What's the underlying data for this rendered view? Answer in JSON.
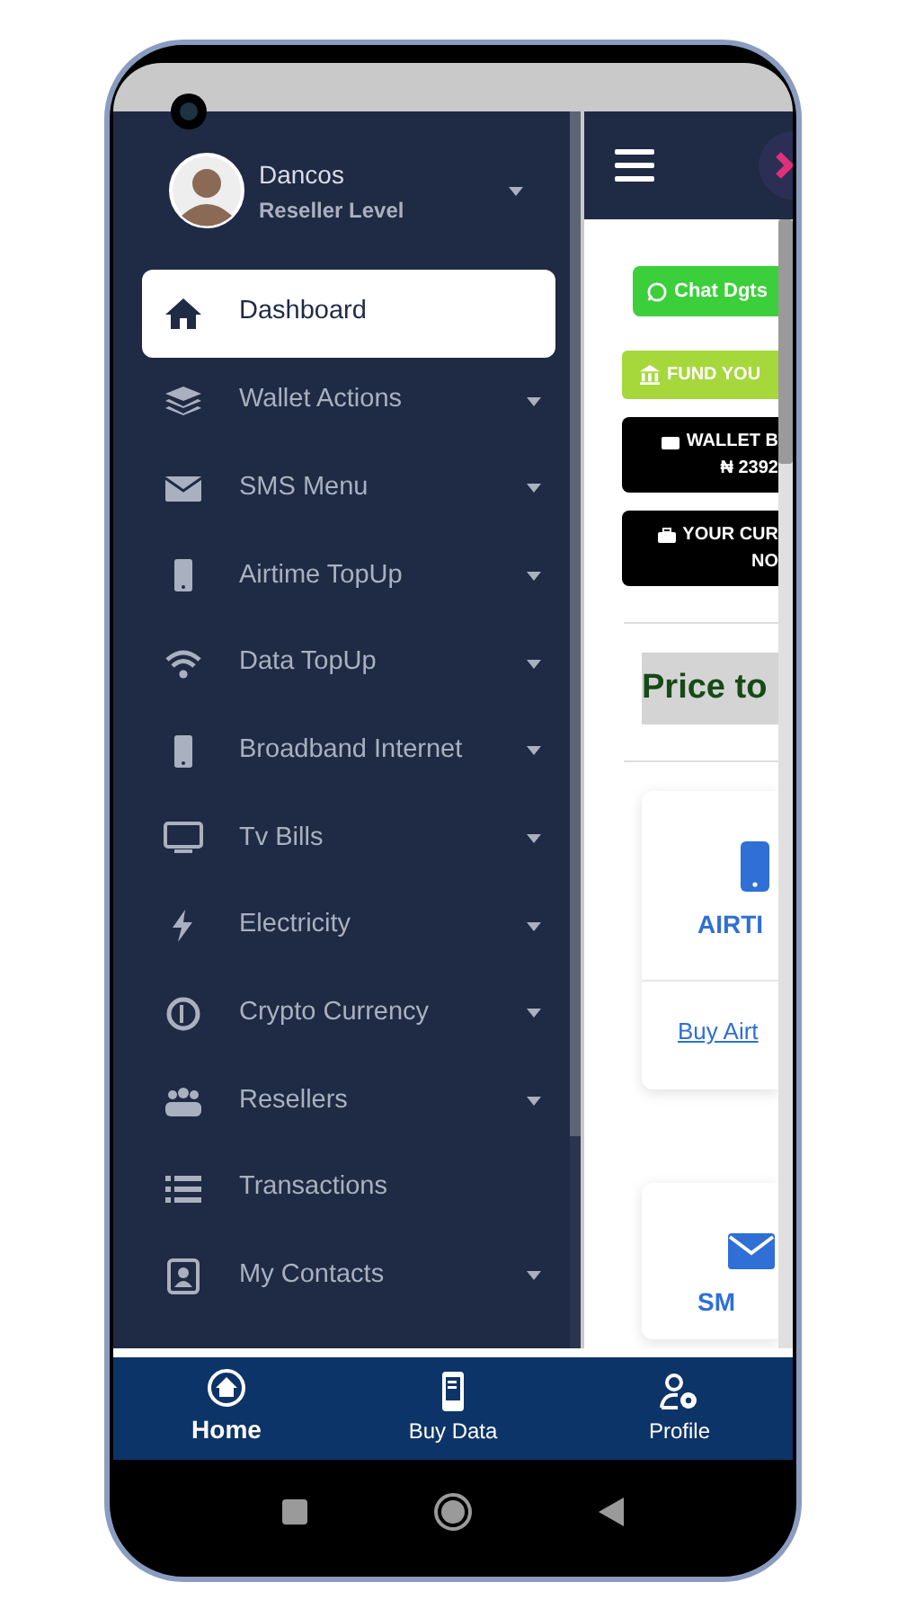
{
  "user": {
    "name": "Dancos",
    "level": "Reseller Level"
  },
  "sidebar": {
    "items": [
      {
        "label": "Dashboard",
        "selected": true,
        "has_submenu": false
      },
      {
        "label": "Wallet Actions",
        "selected": false,
        "has_submenu": true
      },
      {
        "label": "SMS Menu",
        "selected": false,
        "has_submenu": true
      },
      {
        "label": "Airtime TopUp",
        "selected": false,
        "has_submenu": true
      },
      {
        "label": "Data TopUp",
        "selected": false,
        "has_submenu": true
      },
      {
        "label": "Broadband Internet",
        "selected": false,
        "has_submenu": true
      },
      {
        "label": "Tv Bills",
        "selected": false,
        "has_submenu": true
      },
      {
        "label": "Electricity",
        "selected": false,
        "has_submenu": true
      },
      {
        "label": "Crypto Currency",
        "selected": false,
        "has_submenu": true
      },
      {
        "label": "Resellers",
        "selected": false,
        "has_submenu": true
      },
      {
        "label": "Transactions",
        "selected": false,
        "has_submenu": false
      },
      {
        "label": "My Contacts",
        "selected": false,
        "has_submenu": true
      }
    ]
  },
  "main": {
    "chat_button": "Chat Dgts",
    "fund_button": "FUND YOU",
    "info_boxes": [
      {
        "title": "WALLET B",
        "value": "₦ 2392"
      },
      {
        "title": "YOUR CUR",
        "value": "NO"
      }
    ],
    "heading": "Price to",
    "service_cards": [
      {
        "title": "AIRTI",
        "link": "Buy Airt"
      },
      {
        "title": "SM"
      }
    ]
  },
  "bottom_nav": [
    {
      "label": "Home",
      "selected": true
    },
    {
      "label": "Buy Data",
      "selected": false
    },
    {
      "label": "Profile",
      "selected": false
    }
  ]
}
